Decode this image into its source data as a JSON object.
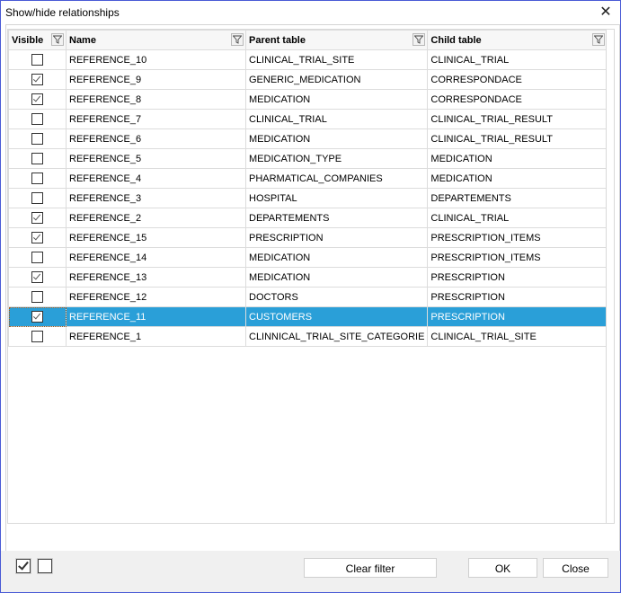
{
  "window": {
    "title": "Show/hide relationships",
    "close_icon": "close-icon"
  },
  "grid": {
    "columns": [
      {
        "key": "visible",
        "label": "Visible",
        "filter_icon": "filter-icon"
      },
      {
        "key": "name",
        "label": "Name",
        "filter_icon": "filter-icon"
      },
      {
        "key": "parent",
        "label": "Parent table",
        "filter_icon": "filter-icon"
      },
      {
        "key": "child",
        "label": "Child table",
        "filter_icon": "filter-icon"
      }
    ],
    "rows": [
      {
        "visible": false,
        "name": "REFERENCE_10",
        "parent": "CLINICAL_TRIAL_SITE",
        "child": "CLINICAL_TRIAL"
      },
      {
        "visible": true,
        "name": "REFERENCE_9",
        "parent": "GENERIC_MEDICATION",
        "child": "CORRESPONDACE"
      },
      {
        "visible": true,
        "name": "REFERENCE_8",
        "parent": "MEDICATION",
        "child": "CORRESPONDACE"
      },
      {
        "visible": false,
        "name": "REFERENCE_7",
        "parent": "CLINICAL_TRIAL",
        "child": "CLINICAL_TRIAL_RESULT"
      },
      {
        "visible": false,
        "name": "REFERENCE_6",
        "parent": "MEDICATION",
        "child": "CLINICAL_TRIAL_RESULT"
      },
      {
        "visible": false,
        "name": "REFERENCE_5",
        "parent": "MEDICATION_TYPE",
        "child": "MEDICATION"
      },
      {
        "visible": false,
        "name": "REFERENCE_4",
        "parent": "PHARMATICAL_COMPANIES",
        "child": "MEDICATION"
      },
      {
        "visible": false,
        "name": "REFERENCE_3",
        "parent": "HOSPITAL",
        "child": "DEPARTEMENTS"
      },
      {
        "visible": true,
        "name": "REFERENCE_2",
        "parent": "DEPARTEMENTS",
        "child": "CLINICAL_TRIAL"
      },
      {
        "visible": true,
        "name": "REFERENCE_15",
        "parent": "PRESCRIPTION",
        "child": "PRESCRIPTION_ITEMS"
      },
      {
        "visible": false,
        "name": "REFERENCE_14",
        "parent": "MEDICATION",
        "child": "PRESCRIPTION_ITEMS"
      },
      {
        "visible": true,
        "name": "REFERENCE_13",
        "parent": "MEDICATION",
        "child": "PRESCRIPTION"
      },
      {
        "visible": false,
        "name": "REFERENCE_12",
        "parent": "DOCTORS",
        "child": "PRESCRIPTION"
      },
      {
        "visible": true,
        "name": "REFERENCE_11",
        "parent": "CUSTOMERS",
        "child": "PRESCRIPTION",
        "selected": true
      },
      {
        "visible": false,
        "name": "REFERENCE_1",
        "parent": "CLINNICAL_TRIAL_SITE_CATEGORIE",
        "child": "CLINICAL_TRIAL_SITE"
      }
    ],
    "selection_color": "#2a9fd8"
  },
  "footer": {
    "check_all": {
      "checked": true,
      "icon": "check-all-icon"
    },
    "uncheck_all": {
      "checked": false,
      "icon": "uncheck-all-icon"
    },
    "clear_filter_label": "Clear filter",
    "ok_label": "OK",
    "close_label": "Close"
  }
}
